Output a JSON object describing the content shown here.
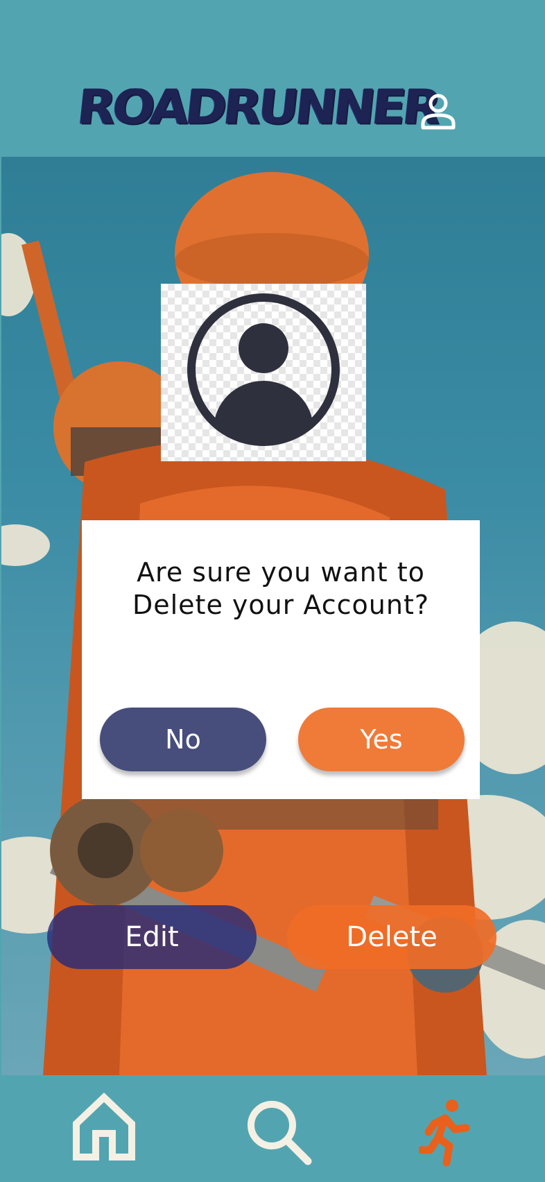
{
  "header": {
    "logo_text": "ROADRUNNER",
    "profile_icon": "user-outline-icon"
  },
  "avatar": {
    "icon": "user-circle-icon"
  },
  "dialog": {
    "line1": "Are sure you want to",
    "line2": "Delete your Account?",
    "no_label": "No",
    "yes_label": "Yes"
  },
  "actions": {
    "edit_label": "Edit",
    "delete_label": "Delete"
  },
  "nav": {
    "items": [
      "home-icon",
      "search-icon",
      "runner-icon"
    ],
    "active": "runner-icon"
  },
  "colors": {
    "teal": "#52a5b0",
    "navy": "#474e7c",
    "orange": "#f07a38",
    "logo": "#1d2352"
  }
}
